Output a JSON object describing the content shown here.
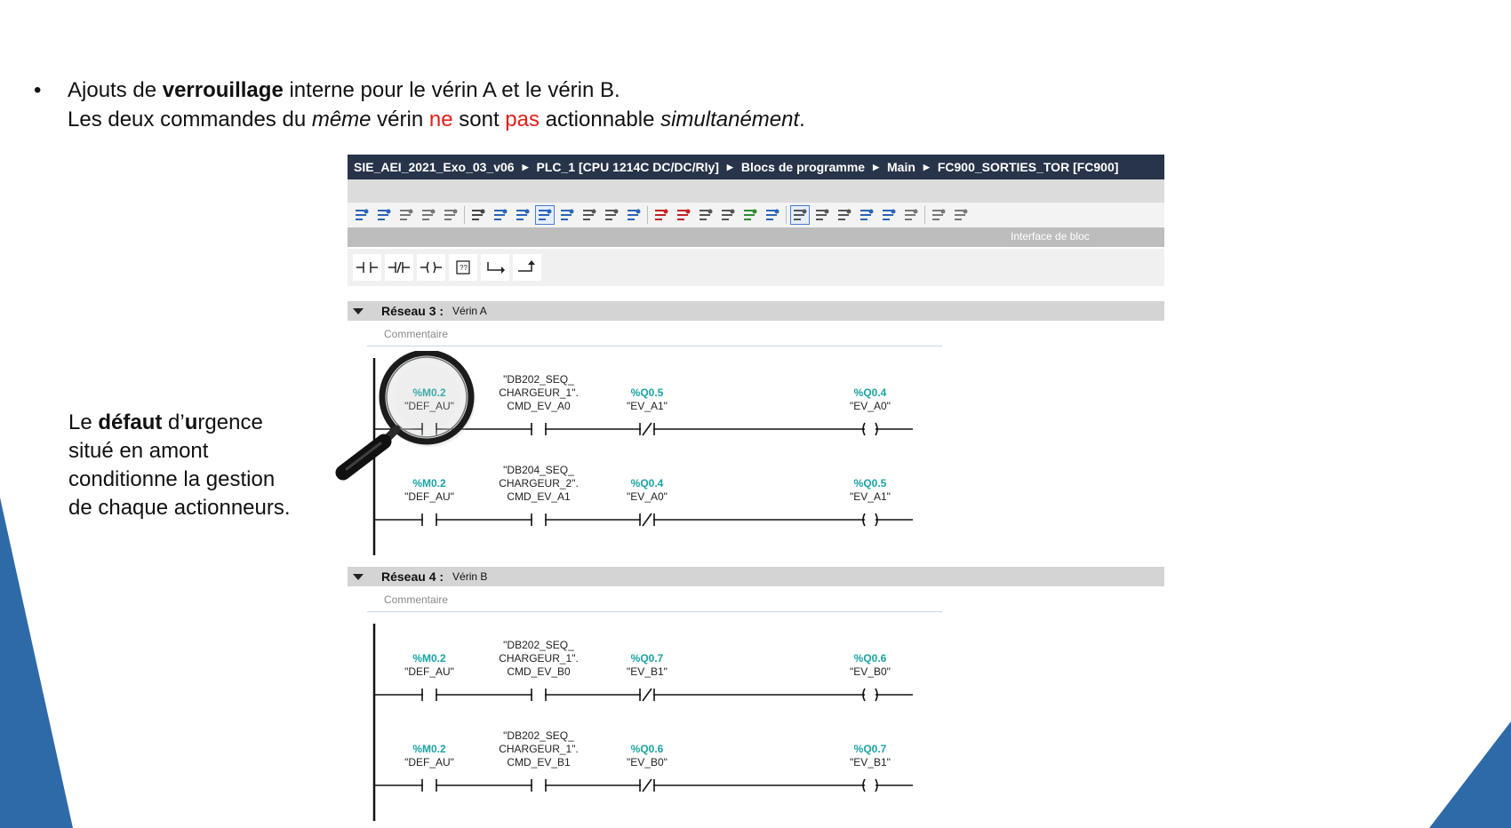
{
  "slide": {
    "bullet_char": "•",
    "line1": {
      "p1": "Ajouts de ",
      "bold": "verrouillage",
      "p2": " interne pour le vérin A et le vérin B."
    },
    "line2": {
      "p1": "Les deux commandes du ",
      "italic": "même",
      "p2": " vérin ",
      "red1": "ne",
      "p3": " sont ",
      "red2": "pas",
      "p4": " actionnable ",
      "italic2": "simultanément",
      "p5": "."
    },
    "note": {
      "l1a": "Le ",
      "l1b": "défaut",
      "l1c": " d’",
      "l1d": "u",
      "l1e": "rgence",
      "l2": "situé en amont",
      "l3": "conditionne la gestion",
      "l4": "de chaque actionneurs."
    },
    "colors": {
      "accent_blue": "#2f6aa8",
      "text_red": "#e0201a"
    }
  },
  "tia": {
    "breadcrumb": [
      "SIE_AEI_2021_Exo_03_v06",
      "PLC_1 [CPU 1214C DC/DC/Rly]",
      "Blocs de programme",
      "Main",
      "FC900_SORTIES_TOR [FC900]"
    ],
    "interface_label": "Interface de bloc",
    "toolbar_icons": [
      "monitor-on-icon",
      "monitor-off-icon",
      "compile-icon",
      "download-icon",
      "block-icon",
      "network-view-icon",
      "table-view-icon",
      "list-view-icon",
      "comment-toggle-icon",
      "insert-network-icon",
      "delete-network-icon",
      "go-to-icon",
      "breakpoint-icon",
      "favorites-icon",
      "abs-icon",
      "rel-icon",
      "link-icon",
      "step-icon",
      "cross-ref-icon",
      "jump-icon",
      "first-icon",
      "last-icon",
      "up-icon",
      "down-icon",
      "compare-icon",
      "filter-icon",
      "db-icon"
    ],
    "instructions": [
      {
        "icon": "no-contact-icon",
        "glyph": "⊣⊢"
      },
      {
        "icon": "nc-contact-icon",
        "glyph": "⊣/⊢"
      },
      {
        "icon": "coil-icon",
        "glyph": "−()−"
      },
      {
        "icon": "empty-box-icon",
        "glyph": "??"
      },
      {
        "icon": "open-branch-icon",
        "glyph": "↳"
      },
      {
        "icon": "close-branch-icon",
        "glyph": "↱"
      }
    ],
    "networks": [
      {
        "title": "Réseau 3 :",
        "subtitle": "Vérin A",
        "comment": "Commentaire",
        "rungs": [
          {
            "c1_addr": "%M0.2",
            "c1_name": "\"DEF_AU\"",
            "c2_l1": "\"DB202_SEQ_",
            "c2_l2": "CHARGEUR_1\".",
            "c2_l3": "CMD_EV_A0",
            "c3_addr": "%Q0.5",
            "c3_name": "\"EV_A1\"",
            "coil_addr": "%Q0.4",
            "coil_name": "\"EV_A0\""
          },
          {
            "c1_addr": "%M0.2",
            "c1_name": "\"DEF_AU\"",
            "c2_l1": "\"DB204_SEQ_",
            "c2_l2": "CHARGEUR_2\".",
            "c2_l3": "CMD_EV_A1",
            "c3_addr": "%Q0.4",
            "c3_name": "\"EV_A0\"",
            "coil_addr": "%Q0.5",
            "coil_name": "\"EV_A1\""
          }
        ]
      },
      {
        "title": "Réseau 4 :",
        "subtitle": "Vérin B",
        "comment": "Commentaire",
        "rungs": [
          {
            "c1_addr": "%M0.2",
            "c1_name": "\"DEF_AU\"",
            "c2_l1": "\"DB202_SEQ_",
            "c2_l2": "CHARGEUR_1\".",
            "c2_l3": "CMD_EV_B0",
            "c3_addr": "%Q0.7",
            "c3_name": "\"EV_B1\"",
            "coil_addr": "%Q0.6",
            "coil_name": "\"EV_B0\""
          },
          {
            "c1_addr": "%M0.2",
            "c1_name": "\"DEF_AU\"",
            "c2_l1": "\"DB202_SEQ_",
            "c2_l2": "CHARGEUR_1\".",
            "c2_l3": "CMD_EV_B1",
            "c3_addr": "%Q0.6",
            "c3_name": "\"EV_B0\"",
            "coil_addr": "%Q0.7",
            "coil_name": "\"EV_B1\""
          }
        ]
      }
    ]
  }
}
